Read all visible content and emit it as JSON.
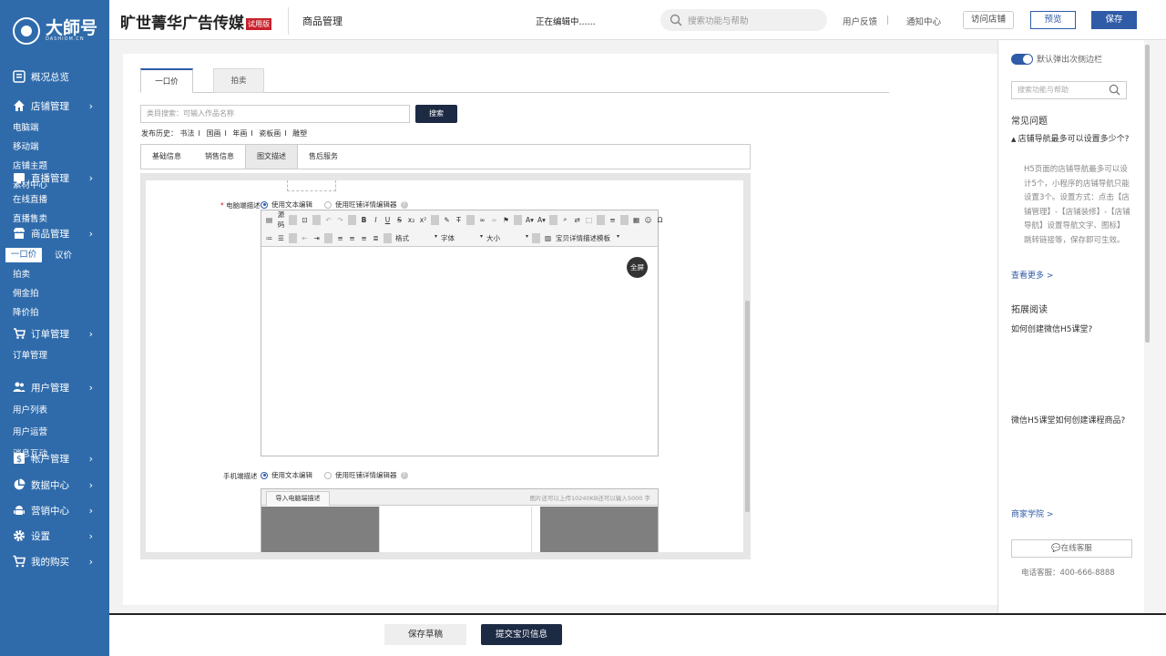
{
  "brand": {
    "logo_text": "大師号",
    "logo_sub": "DASHIOM.CN"
  },
  "sidebar": {
    "overview": "概况总览",
    "store": {
      "label": "店铺管理",
      "items": [
        "电脑端",
        "移动端",
        "店铺主题",
        "素材中心"
      ]
    },
    "live": {
      "label": "直播管理",
      "items": [
        "在线直播",
        "直播售卖"
      ]
    },
    "goods": {
      "label": "商品管理",
      "items": [
        "一口价",
        "议价",
        "拍卖",
        "佣金拍",
        "降价拍"
      ]
    },
    "orders": {
      "label": "订单管理",
      "items": [
        "订单管理"
      ]
    },
    "users": {
      "label": "用户管理",
      "items": [
        "用户列表",
        "用户运营",
        "消息互动"
      ]
    },
    "account": {
      "label": "帐户管理"
    },
    "data": {
      "label": "数据中心"
    },
    "marketing": {
      "label": "营销中心"
    },
    "settings": {
      "label": "设置"
    },
    "purchase": {
      "label": "我的购买"
    }
  },
  "topbar": {
    "title": "旷世菁华广告传媒",
    "trial": "试用版",
    "section": "商品管理",
    "editing": "正在编辑中......",
    "search_placeholder": "搜索功能与帮助",
    "feedback": "用户反馈",
    "notify": "通知中心",
    "visit": "访问店铺",
    "preview": "预览",
    "save": "保存"
  },
  "main": {
    "tabs": [
      "一口价",
      "拍卖"
    ],
    "category_placeholder": "类目搜索：可输入作品名称",
    "search_btn": "搜索",
    "history_label": "发布历史：",
    "history": [
      "书法",
      "国画",
      "年画",
      "瓷板画",
      "雕塑"
    ],
    "subtabs": [
      "基础信息",
      "销售信息",
      "图文描述",
      "售后服务"
    ],
    "pc_desc_label": "电脑端描述",
    "mobile_desc_label": "手机端描述",
    "opt_text": "使用文本编辑",
    "opt_wangpu": "使用旺铺详情编辑器",
    "toolbar_source": "源码",
    "toolbar_format": "格式",
    "toolbar_font": "字体",
    "toolbar_size": "大小",
    "toolbar_template": "宝贝详情描述模板",
    "fullscreen": "全屏",
    "import_pc": "导入电脑端描述",
    "upload_note": "图片还可以上传10240KB还可以输入5000 字"
  },
  "bottom": {
    "draft": "保存草稿",
    "submit": "提交宝贝信息"
  },
  "rpanel": {
    "toggle_label": "默认弹出次侧边栏",
    "search_placeholder": "搜索功能与帮助",
    "faq_title": "常见问题",
    "faq_q": "店铺导航最多可以设置多少个?",
    "faq_a": "H5页面的店铺导航最多可以设计5个，小程序的店铺导航只能设置3个。设置方式：点击【店铺管理】-【店铺装修】-【店铺导航】设置导航文字、图标】跳转链接等，保存即可生效。",
    "more": "查看更多 >",
    "ext_title": "拓展阅读",
    "ext1": "如何创建微信H5课堂?",
    "ext2": "微信H5课堂如何创建课程商品?",
    "academy": "商家学院 >",
    "online": "在线客服",
    "phone": "电话客服：400-666-8888"
  },
  "colors": {
    "sidebar": "#2f6bab",
    "primary": "#2f5ba7",
    "dark_btn": "#1d2a44",
    "trial": "#c9202b"
  }
}
